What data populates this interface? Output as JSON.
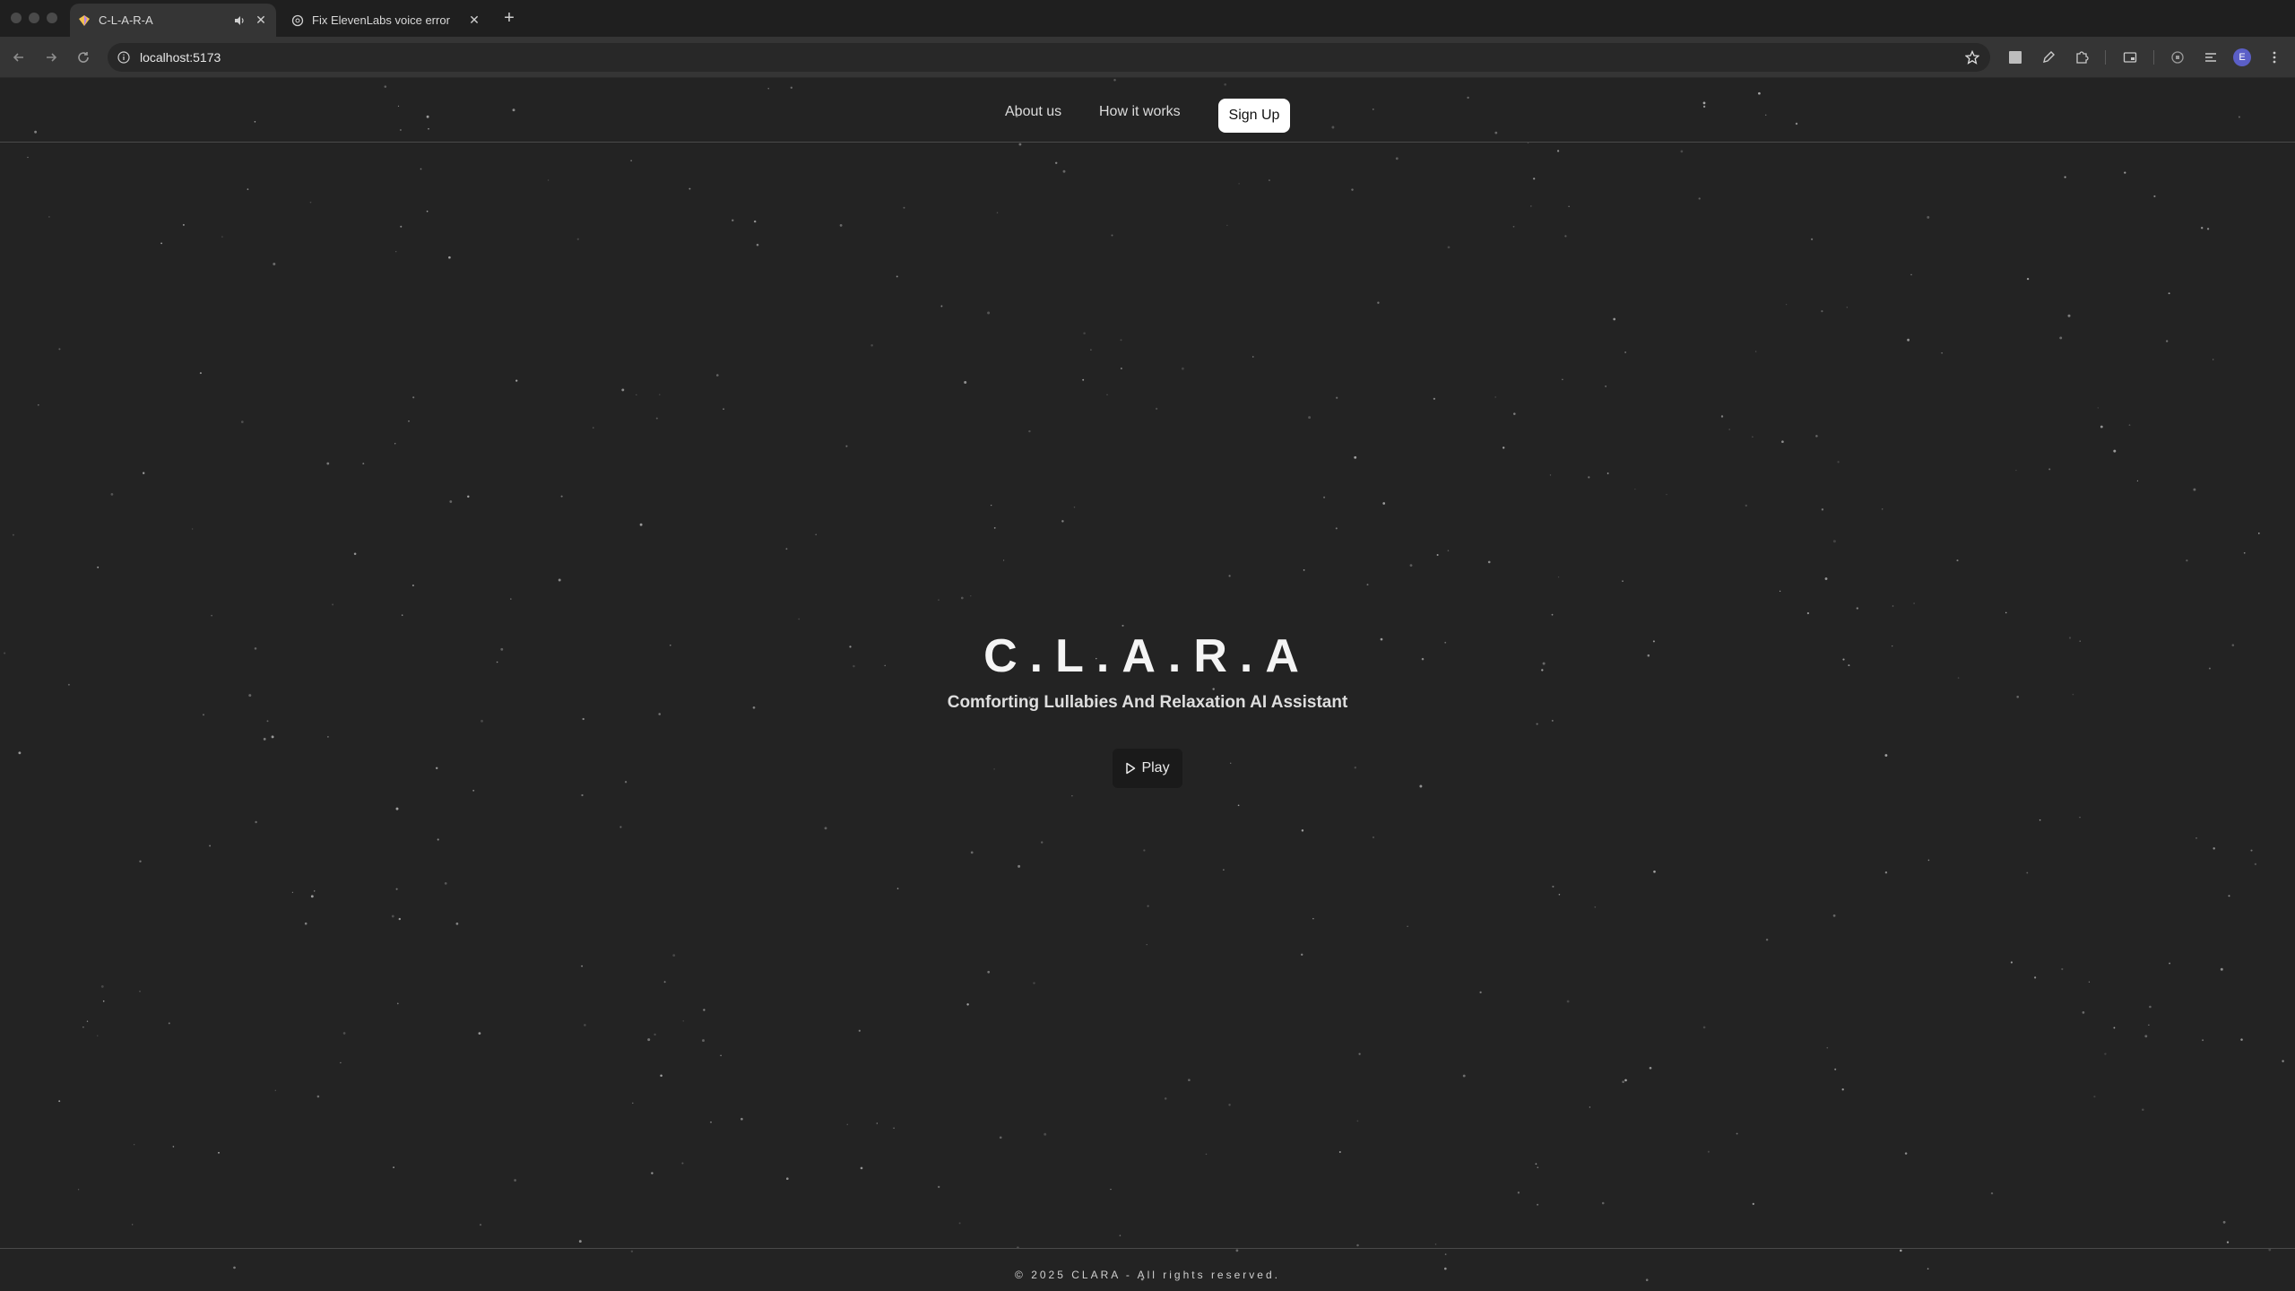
{
  "browser": {
    "tabs": [
      {
        "title": "C-L-A-R-A",
        "active": true
      },
      {
        "title": "Fix ElevenLabs voice error",
        "active": false
      }
    ],
    "url": "localhost:5173",
    "profile_initial": "E"
  },
  "nav": {
    "about": "About us",
    "how": "How it works",
    "signup": "Sign Up"
  },
  "hero": {
    "title": "C.L.A.R.A",
    "subtitle": "Comforting Lullabies And Relaxation AI Assistant",
    "play_label": "Play"
  },
  "footer": {
    "text": "© 2025 CLARA - All rights reserved."
  },
  "colors": {
    "background": "#232323",
    "button_light": "#ffffff",
    "play_bg": "#1a1a1a",
    "profile": "#5b5fc7"
  }
}
